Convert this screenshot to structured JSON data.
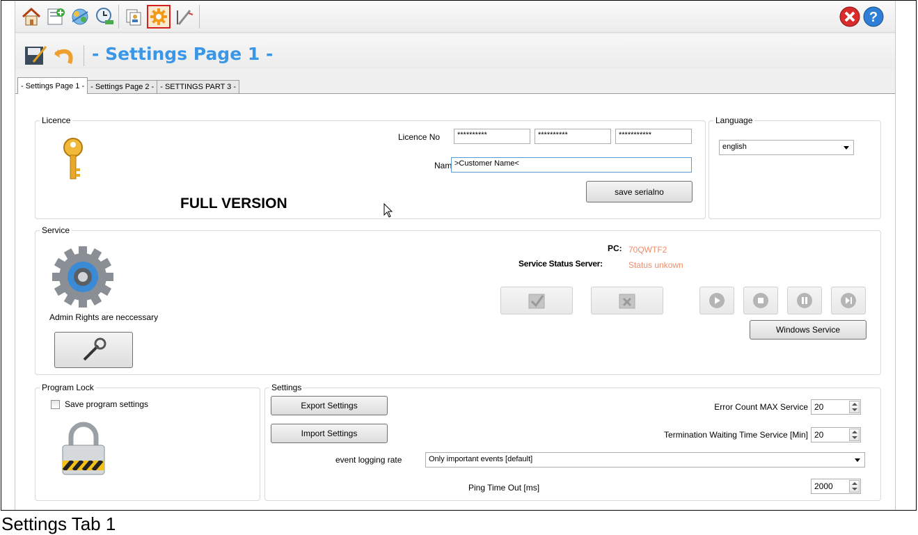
{
  "window": {
    "page_title": "- Settings Page 1 -"
  },
  "toolbar": {
    "buttons": [
      {
        "icon": "home-icon"
      },
      {
        "icon": "new-document-icon"
      },
      {
        "icon": "network-icon"
      },
      {
        "icon": "schedule-icon"
      },
      {
        "icon": "copy-user-icon"
      },
      {
        "icon": "settings-gear-icon",
        "active": true
      },
      {
        "icon": "edit-brush-icon"
      }
    ],
    "right": [
      {
        "icon": "close-icon"
      },
      {
        "icon": "help-icon"
      }
    ]
  },
  "tabs": [
    "- Settings Page 1 -",
    "- Settings Page 2 -",
    "- SETTINGS PART 3 -"
  ],
  "licence": {
    "legend": "Licence",
    "licence_no_label": "Licence No",
    "licence_parts": [
      "**********",
      "**********",
      "***********"
    ],
    "name_label": "Name",
    "name_value": ">Customer Name<",
    "version_text": "FULL VERSION",
    "save_button": "save serialno"
  },
  "language": {
    "legend": "Language",
    "selected": "english"
  },
  "service": {
    "legend": "Service",
    "pc_label": "PC:",
    "pc_value": "70QWTF2",
    "status_label": "Service Status Server:",
    "status_value": "Status unkown",
    "admin_text": "Admin Rights are neccessary",
    "windows_service_button": "Windows Service"
  },
  "program_lock": {
    "legend": "Program Lock",
    "save_checkbox_label": "Save program settings",
    "checked": false
  },
  "settings": {
    "legend": "Settings",
    "export_button": "Export Settings",
    "import_button": "Import Settings",
    "error_count_label": "Error Count MAX Service",
    "error_count_value": "20",
    "termination_label": "Termination Waiting Time Service [Min]",
    "termination_value": "20",
    "event_logging_label": "event logging rate",
    "event_logging_value": "Only important events [default]",
    "ping_label": "Ping Time Out [ms]",
    "ping_value": "2000"
  },
  "caption": "Settings Tab 1",
  "colors": {
    "title": "#3a97e8",
    "status": "#f08c6a",
    "active_border": "#d61f1f"
  }
}
